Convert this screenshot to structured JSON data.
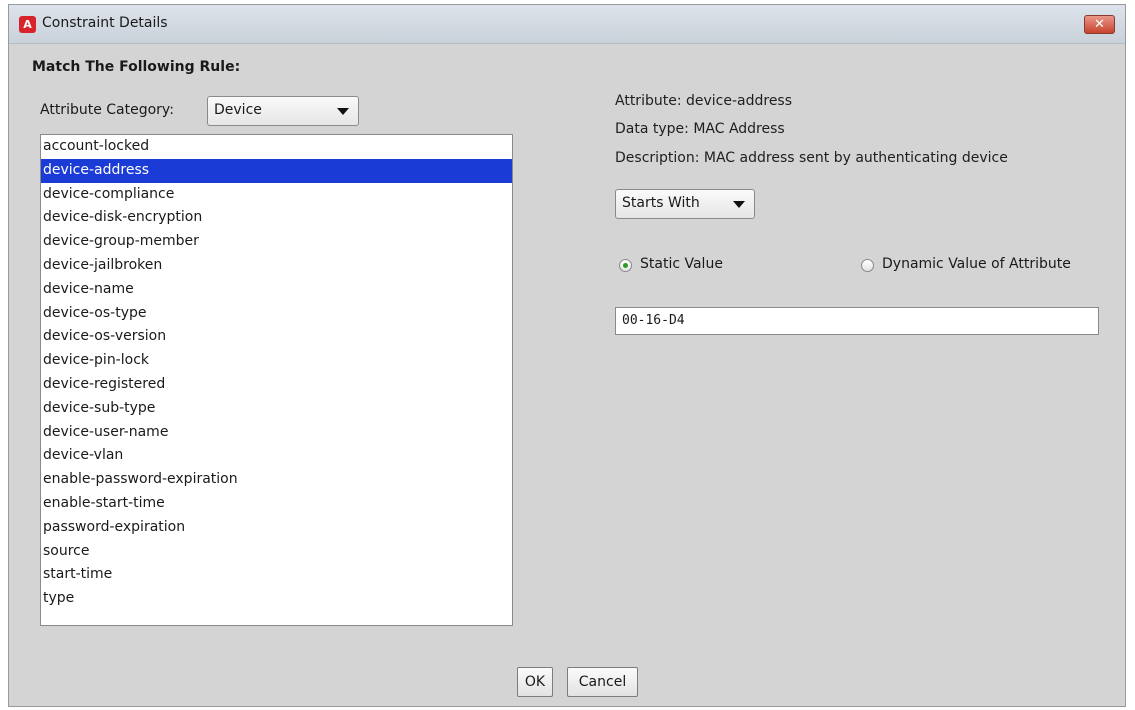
{
  "window": {
    "title": "Constraint Details",
    "app_icon_letter": "A",
    "close_label": "✕"
  },
  "rule_heading": "Match The Following Rule:",
  "category": {
    "label": "Attribute Category:",
    "selected": "Device"
  },
  "attributes": [
    "account-locked",
    "device-address",
    "device-compliance",
    "device-disk-encryption",
    "device-group-member",
    "device-jailbroken",
    "device-name",
    "device-os-type",
    "device-os-version",
    "device-pin-lock",
    "device-registered",
    "device-sub-type",
    "device-user-name",
    "device-vlan",
    "enable-password-expiration",
    "enable-start-time",
    "password-expiration",
    "source",
    "start-time",
    "type"
  ],
  "selected_attribute": "device-address",
  "details": {
    "attribute": "Attribute: device-address",
    "data_type": "Data type: MAC Address",
    "description": "Description: MAC address sent by authenticating device"
  },
  "operator": {
    "selected": "Starts With"
  },
  "value_mode": {
    "static_label": "Static Value",
    "dynamic_label": "Dynamic Value of Attribute",
    "selected": "static"
  },
  "value_input": "00-16-D4",
  "buttons": {
    "ok": "OK",
    "cancel": "Cancel"
  },
  "colors": {
    "selection": "#1a3bd6",
    "radio_selected": "#2d9a28",
    "close_button": "#c7432f",
    "app_icon": "#d9232a"
  }
}
